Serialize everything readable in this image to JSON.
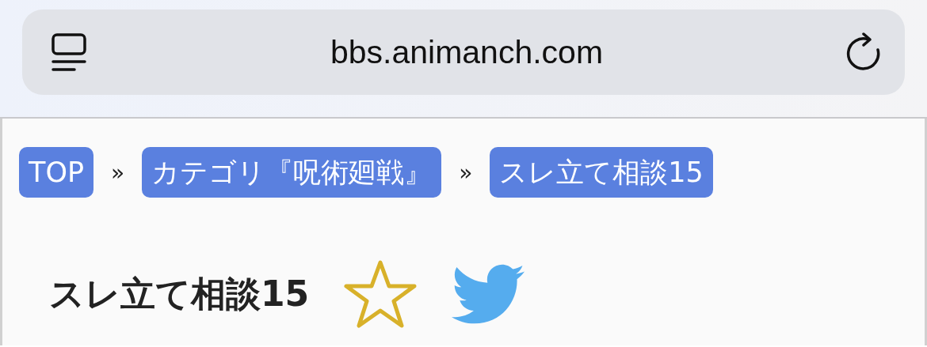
{
  "address_bar": {
    "url": "bbs.animanch.com"
  },
  "breadcrumbs": [
    {
      "kind": "link",
      "label": "TOP"
    },
    {
      "kind": "separator",
      "label": "»"
    },
    {
      "kind": "link",
      "label": "カテゴリ『呪術廻戦』"
    },
    {
      "kind": "separator",
      "label": "»"
    },
    {
      "kind": "link",
      "label": "スレ立て相談15"
    }
  ],
  "thread": {
    "title": "スレ立て相談15"
  }
}
